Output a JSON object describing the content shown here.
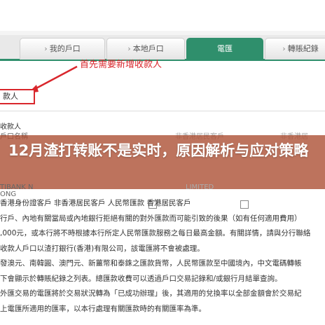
{
  "tabs": [
    {
      "label": "我的戶口",
      "active": false
    },
    {
      "label": "本地戶口",
      "active": false
    },
    {
      "label": "電匯",
      "active": true
    },
    {
      "label": "轉賬紀錄",
      "active": false
    }
  ],
  "annotation": "首先需要新增收款人",
  "recipient_field": "款人",
  "section_header": "收款人",
  "ghost": {
    "row1_left": "戶口名稱",
    "row1_mid": "非香港居民客戶",
    "row1_right": "非香港居",
    "row2_left": "TIBANK N",
    "row2_right": "LIMITED",
    "row3_left": "ONG"
  },
  "banner_title": "12月渣打转账不是实时，原因解析与应对策略",
  "body_lines": [
    "香港身份證客戶 非香港居民客戶 人民幣匯款 香港居民客戶",
    "行戶、內地有關當局或內地銀行拒絕有關的對外匯款而可能引致的後果（如有任何適用費用）",
    ",000元，或本行將不時根據本行所定人民幣匯款服務之每日最高金額。有關詳情，請與分行聯絡",
    "收款人戶口以渣打銀行(香港)有限公司，該電匯將不會被處理。",
    "發澳元、南韓圓、澳門元、新薑幣和泰銖之匯款貨幣，人民幣匯款至中國境內，中文電碼轉帳",
    "下會顯示於轉賬紀錄之列表。總匯款收費可以透過戶口交易記錄和/或銀行月結單查詢。",
    "外匯交易的電匯將於交易狀況轉為「已成功辦理」後，其適用的兌換率以全部金額會於交易紀",
    "上電匯所適用的匯率，以本行處理有關匯款時的有關匯率為準。"
  ],
  "colors": {
    "accent_green": "#2f8f6c",
    "annotation_red": "#d9262c",
    "banner": "#aa4b30"
  }
}
